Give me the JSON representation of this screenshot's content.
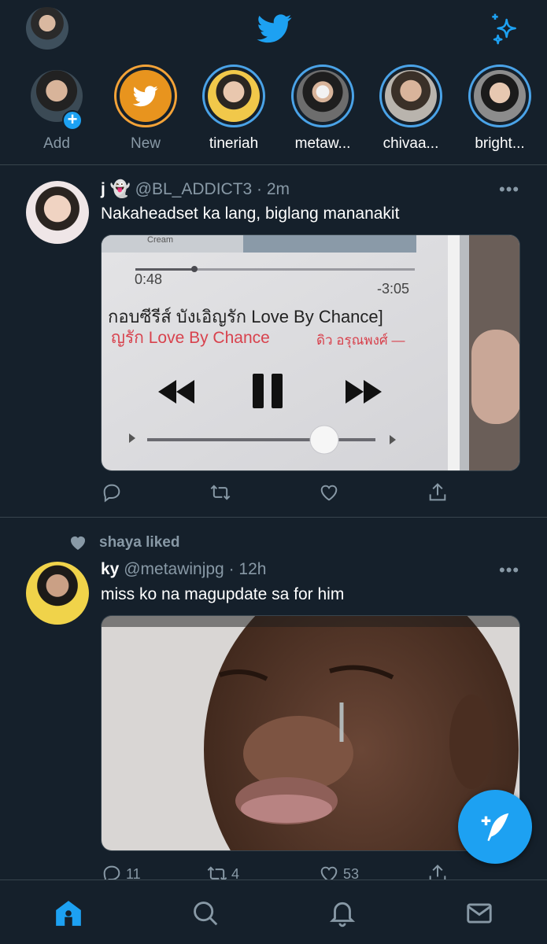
{
  "header": {
    "profile_icon": "avatar",
    "logo_icon": "twitter-bird-icon",
    "sparkle_icon": "sparkle-icon",
    "accent_color": "#1da1f2"
  },
  "fleets": [
    {
      "label": "Add",
      "type": "add"
    },
    {
      "label": "New",
      "type": "new"
    },
    {
      "label": "tineriah"
    },
    {
      "label": "metaw..."
    },
    {
      "label": "chivaa..."
    },
    {
      "label": "bright..."
    }
  ],
  "tweets": [
    {
      "name": "j 👻",
      "handle": "@BL_ADDICT3",
      "time": "· 2m",
      "text": "Nakaheadset ka lang, biglang mananakit",
      "media": {
        "elapsed": "0:48",
        "remaining": "-3:05",
        "title": "กอบซีรีส์ บังเอิญรัก Love By Chance]",
        "subtitle": "ญรัก Love By Chance",
        "artist": "ดิว อรุณพงศ์ —",
        "top_label": "Cream"
      },
      "actions": {
        "reply": "",
        "retweet": "",
        "like": "",
        "share": ""
      }
    },
    {
      "social_context": "shaya liked",
      "name": "ky",
      "handle": "@metawinjpg",
      "time": "· 12h",
      "text": "miss ko na magupdate sa for him",
      "actions": {
        "reply": "11",
        "retweet": "4",
        "like": "53",
        "share": ""
      }
    }
  ],
  "nav": [
    "home-icon",
    "search-icon",
    "notifications-icon",
    "messages-icon"
  ]
}
